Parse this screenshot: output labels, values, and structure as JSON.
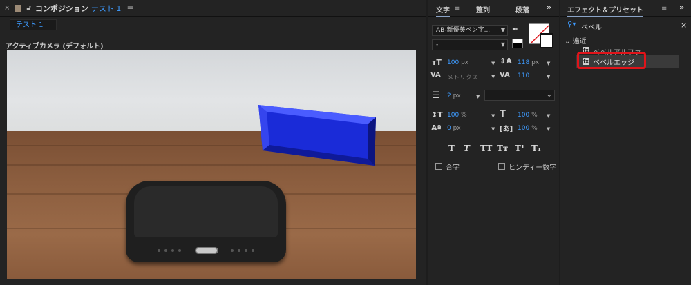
{
  "comp": {
    "close_glyph": "×",
    "composition_label": "コンポジション",
    "composition_name": "テスト 1",
    "subtab_label": "テスト 1",
    "viewer_label": "アクティブカメラ (デフォルト)"
  },
  "character": {
    "tabs": [
      "文字",
      "整列",
      "段落"
    ],
    "font_family": "AB-新優美ペン字...",
    "font_style": "-",
    "font_size": "100",
    "leading": "118",
    "kerning": "メトリクス",
    "tracking": "110",
    "stroke_width": "2",
    "vscale": "100",
    "hscale": "100",
    "baseline_shift": "0",
    "tsume": "100",
    "unit_px": "px",
    "unit_pct": "%",
    "format_buttons": [
      "T",
      "T",
      "TT",
      "Tт",
      "T¹",
      "T₁"
    ],
    "ligatures_label": "合字",
    "hindi_label": "ヒンディー数字"
  },
  "effects": {
    "tab_label": "エフェクト＆プリセット",
    "search_value": "ベベル",
    "recent_group": "遍近",
    "items": [
      "ベベルアルファ",
      "ベベルエッジ"
    ]
  },
  "colors": {
    "accent": "#3e9bff",
    "highlight": "#e0141a",
    "bevel": "#1a2bd8"
  }
}
